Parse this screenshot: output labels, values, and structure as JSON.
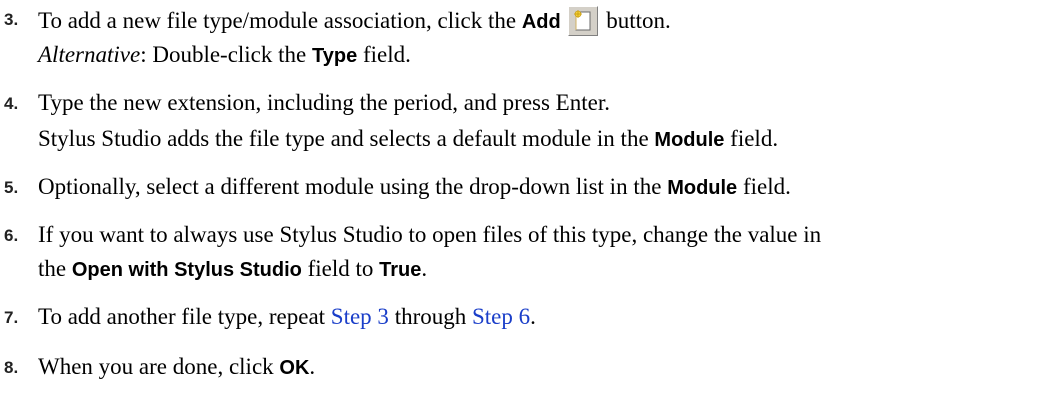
{
  "steps": [
    {
      "num": "3.",
      "line1": {
        "a": "To add a new file type/module association, click the ",
        "b": "Add",
        "icon": "add-new-document-icon",
        "c": " button."
      },
      "line2": {
        "a": "Alternative",
        "b": ": Double-click the ",
        "c": "Type",
        "d": " field."
      }
    },
    {
      "num": "4.",
      "line1": {
        "a": "Type the new extension, including the period, and press Enter."
      },
      "line2": {
        "a": "Stylus Studio adds the file type and selects a default module in the ",
        "b": "Module",
        "c": " field."
      }
    },
    {
      "num": "5.",
      "line1": {
        "a": "Optionally, select a different module using the drop-down list in the ",
        "b": "Module",
        "c": " field."
      }
    },
    {
      "num": "6.",
      "line1": {
        "a": "If you want to always use Stylus Studio to open files of this type, change the value in"
      },
      "line2": {
        "a": "the ",
        "b": "Open with Stylus Studio",
        "c": " field to ",
        "d": "True",
        "e": "."
      }
    },
    {
      "num": "7.",
      "line1": {
        "a": "To add another file type, repeat ",
        "link1": "Step 3",
        "b": " through ",
        "link2": "Step 6",
        "c": "."
      }
    },
    {
      "num": "8.",
      "line1": {
        "a": "When you are done, click ",
        "b": "OK",
        "c": "."
      }
    }
  ],
  "colors": {
    "link": "#1a3ec9",
    "text": "#000000"
  }
}
